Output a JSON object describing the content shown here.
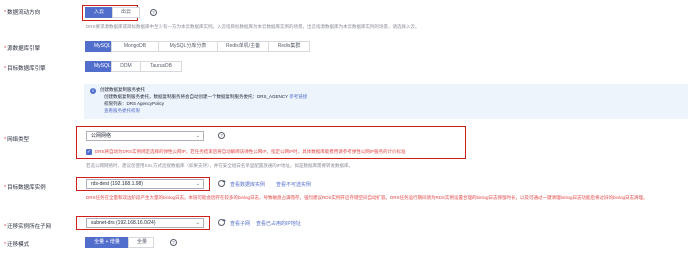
{
  "direction": {
    "label": "数据流动方向",
    "options": [
      "入云",
      "出云"
    ],
    "selected": "入云",
    "hint": "DRS要求源数据库或目标数据库中至少有一方为本云数据库实例。入云指目标数据库为本云数据库实例的场景，出云指源数据库为本云数据库实例的场景，请选择入云。"
  },
  "source_engine": {
    "label": "源数据库引擎",
    "options": [
      "MySQL",
      "MongoDB",
      "MySQL分库分表",
      "Redis单机/主备",
      "Redis集群"
    ],
    "selected": "MySQL"
  },
  "target_engine": {
    "label": "目标数据库引擎",
    "options": [
      "MySQL",
      "DDM",
      "TaurusDB"
    ],
    "selected": "MySQL"
  },
  "info": {
    "title": "创建数据复制服务委托",
    "line1": "创建数据复制服务委托，数据复制服务将会自动创建一个数据复制服务委托：DRS_AGENCY",
    "line1_link": "参考链接",
    "line2": "权限列表：DRS AgencyPolicy",
    "line3_link": "查看服务委托权限"
  },
  "network": {
    "label": "网络类型",
    "value": "公网网络",
    "checkbox_text": "DRS将自动为DRS实例绑定选择的弹性公网IP，若任务结束后将自动解绑该弹性公网IP。指定公网IP时，具体数据库能费用请参考弹性公网IP服务的计价标准",
    "hint": "若选公网网络时，建议您使用SSL方式连接数据库（如果支持），并在安全组白名单里配置放通的IP地址。如是数据库需要转发数据库。"
  },
  "target_instance": {
    "label": "目标数据库实例",
    "value": "rds-dest (192.168.1.98)",
    "link1": "查看数据库实例",
    "link2": "查看不可选实例",
    "hint": "DRS任务在全量和双边阶段产生大量的binlog日志。本链可能会因存在较多的binlog日志，导致磁盘占满而存。强烈建议RDS实例开启存储空间自动扩容。DRS任务运行期间请为RDS实例设置合理的binlog日志保留时长，以及可通过一键清理binlog日志功能后将过旧的binlog日志清理。"
  },
  "subnet": {
    "label": "迁移实例所在子网",
    "value": "subnet-drs (192.168.16.0/24)",
    "link1": "查看子网",
    "link2": "查看已占用的IP地址"
  },
  "migration_mode": {
    "label": "迁移模式",
    "options": [
      "全量 + 增量",
      "全量"
    ],
    "selected": "全量 + 增量"
  },
  "colors": {
    "primary": "#526ecc",
    "highlight_border": "#d0201c",
    "hint_red": "#e54545"
  }
}
